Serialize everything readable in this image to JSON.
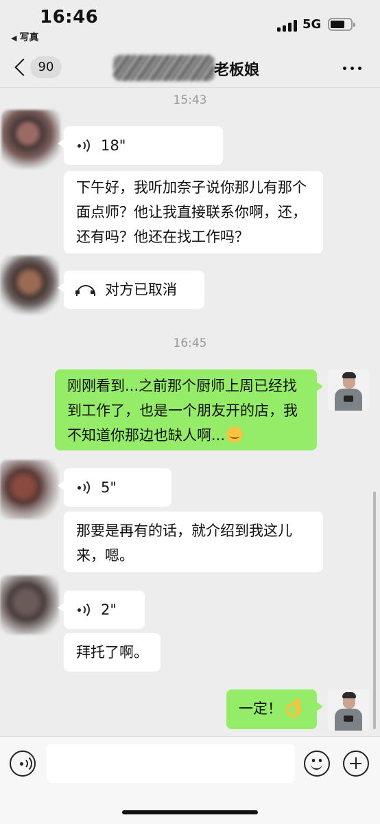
{
  "status_bar": {
    "time": "16:46",
    "back_app": "写真",
    "network": "5G",
    "battery_level": 0.65
  },
  "nav": {
    "unread_count": "90",
    "contact_name_suffix": "老板娘"
  },
  "messages": {
    "timestamp_1": "15:43",
    "voice_1_duration": "18\"",
    "text_1": "下午好，我听加奈子说你那儿有那个面点师？他让我直接联系你啊，还，还有吗？他还在找工作吗？",
    "call_status": "对方已取消",
    "timestamp_2": "16:45",
    "text_2": "刚刚看到...之前那个厨师上周已经找到工作了，也是一个朋友开的店，我不知道你那边也缺人啊...",
    "voice_2_duration": "5\"",
    "text_3": "那要是再有的话，就介绍到我这儿来，嗯。",
    "voice_3_duration": "2\"",
    "text_4": "拜托了啊。",
    "text_5": "一定！"
  },
  "input_bar": {
    "placeholder": ""
  },
  "icons": {
    "back": "chevron-left-icon",
    "more": "more-icon",
    "voice": "voice-icon",
    "call": "hangup-icon",
    "emoji": "emoji-icon",
    "plus": "plus-icon"
  },
  "colors": {
    "background": "#ededed",
    "incoming_bubble": "#ffffff",
    "outgoing_bubble": "#95ec69",
    "timestamp": "#9a9a9a"
  }
}
